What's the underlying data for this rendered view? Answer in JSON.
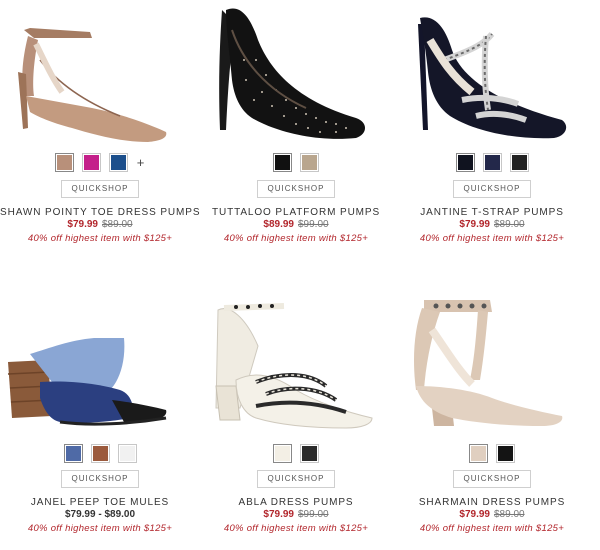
{
  "quickshop_label": "QUICKSHOP",
  "products": [
    {
      "name": "SHAWN POINTY TOE DRESS PUMPS",
      "sale_price": "$79.99",
      "original_price": "$89.00",
      "promo": "40% off highest item with $125+",
      "swatches": [
        "#b8907a",
        "#c41f8a",
        "#1c4f8c"
      ],
      "more_colors": "+"
    },
    {
      "name": "TUTTALOO PLATFORM PUMPS",
      "sale_price": "$89.99",
      "original_price": "$99.00",
      "promo": "40% off highest item with $125+",
      "swatches": [
        "#111111",
        "#b9a68e"
      ]
    },
    {
      "name": "JANTINE T-STRAP PUMPS",
      "sale_price": "$79.99",
      "original_price": "$89.00",
      "promo": "40% off highest item with $125+",
      "swatches": [
        "#10131f",
        "#23284a",
        "#222222"
      ]
    },
    {
      "name": "JANEL PEEP TOE MULES",
      "price_range": "$79.99 - $89.00",
      "promo": "40% off highest item with $125+",
      "swatches": [
        "#4f6aa6",
        "#9b5a3d",
        "#f1f1f1"
      ]
    },
    {
      "name": "ABLA DRESS PUMPS",
      "sale_price": "$79.99",
      "original_price": "$99.00",
      "promo": "40% off highest item with $125+",
      "swatches": [
        "#f3efe5",
        "#2b2b2b"
      ]
    },
    {
      "name": "SHARMAIN DRESS PUMPS",
      "sale_price": "$79.99",
      "original_price": "$89.00",
      "promo": "40% off highest item with $125+",
      "swatches": [
        "#e0cfc0",
        "#141414"
      ]
    }
  ]
}
